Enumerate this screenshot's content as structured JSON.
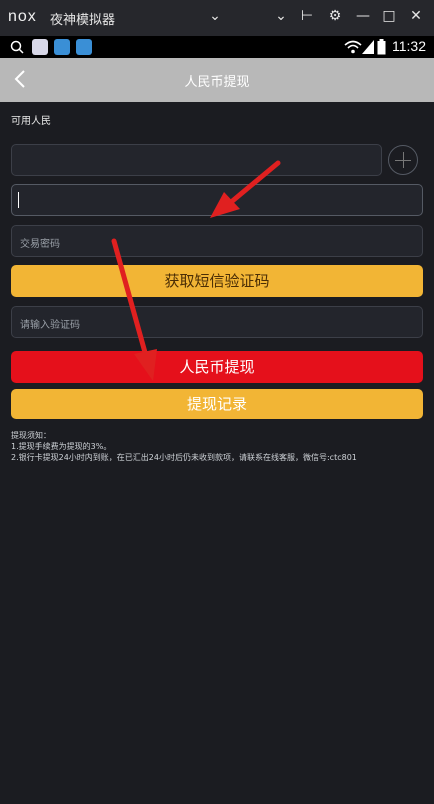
{
  "emulator": {
    "logo": "nox",
    "title": "夜神模拟器"
  },
  "status": {
    "time": "11:32"
  },
  "page": {
    "title": "人民币提现",
    "balance_label": "可用人民"
  },
  "form": {
    "trade_password_placeholder": "交易密码",
    "sms_button": "获取短信验证码",
    "code_placeholder": "请输入验证码",
    "withdraw_button": "人民币提现",
    "records_button": "提现记录"
  },
  "notes": {
    "heading": "提现须知：",
    "line1": "1.提现手续费为提现的3%。",
    "line2": "2.银行卡提现24小时内到账，在已汇出24小时后仍未收到款项，请联系在线客服，微信号:ctc801"
  },
  "colors": {
    "accent_yellow": "#f2b535",
    "accent_red": "#e5101b",
    "arrow_red": "#e02020",
    "navbar_gray": "#b8b8b8",
    "background": "#1b1c21"
  }
}
